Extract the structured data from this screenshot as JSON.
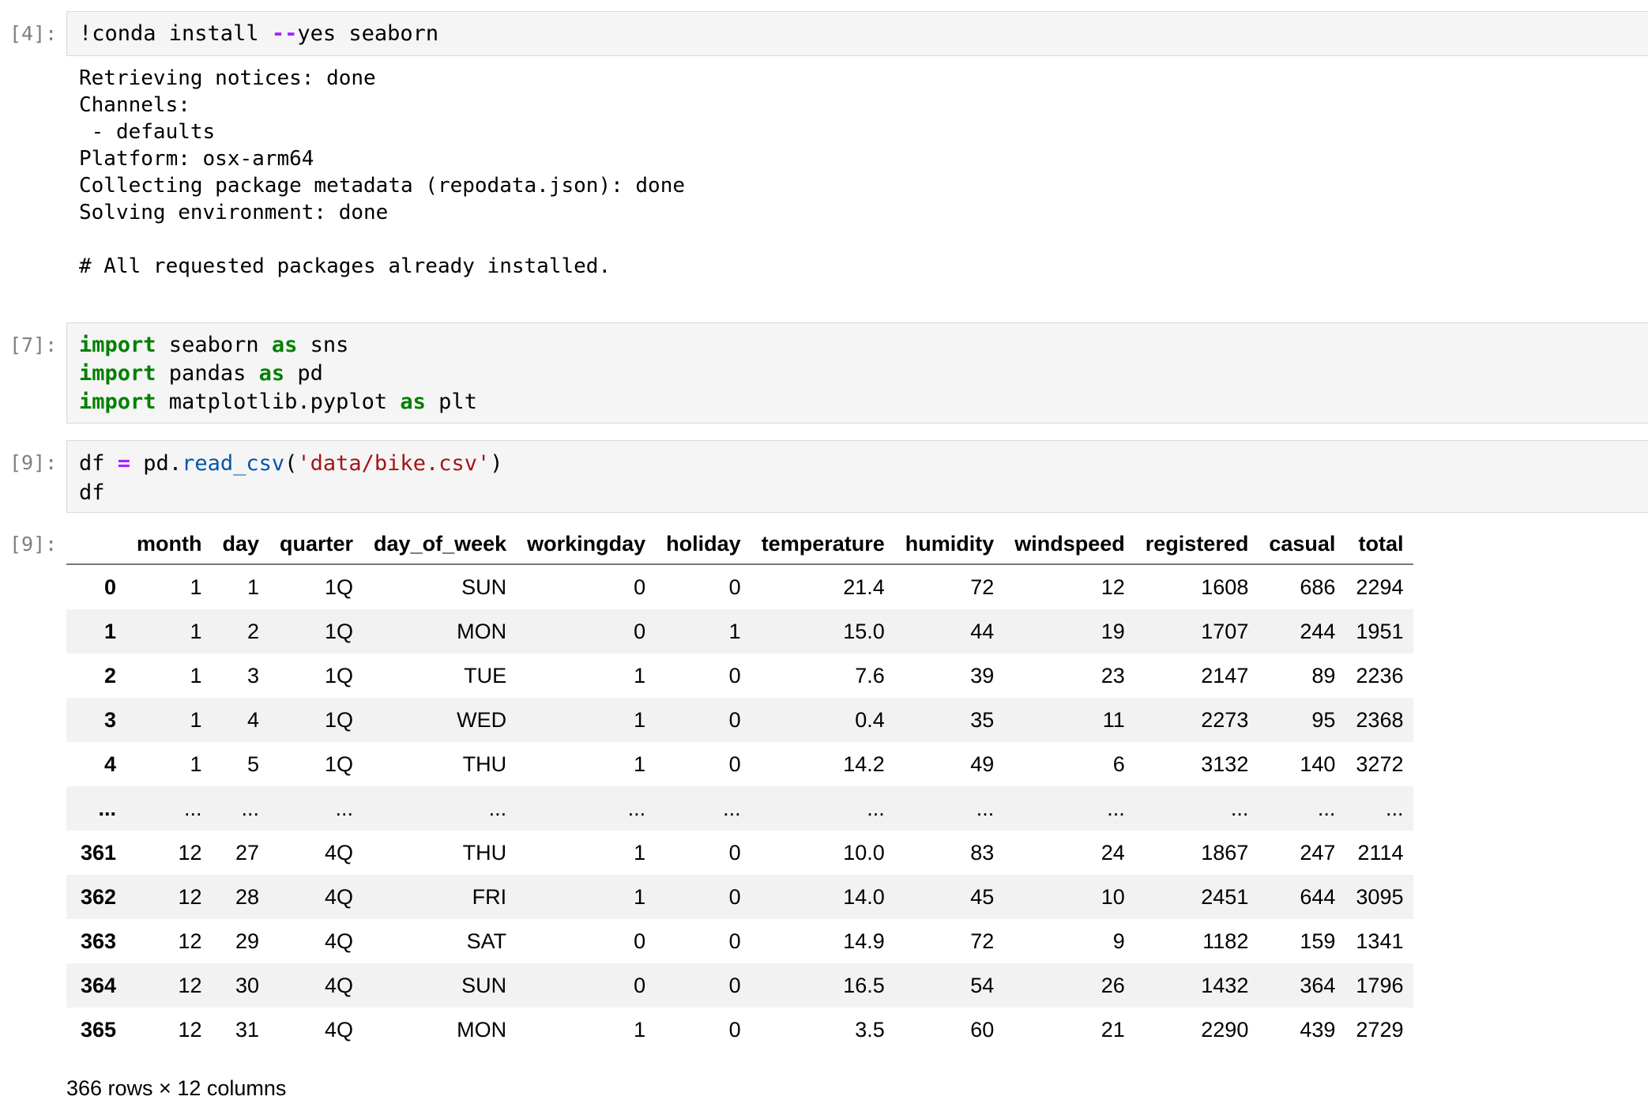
{
  "cells": [
    {
      "prompt": "[4]:",
      "code_parts": {
        "p1": "!conda install ",
        "p2": "--",
        "p3": "yes seaborn"
      },
      "output_lines": [
        "Retrieving notices: done",
        "Channels:",
        " - defaults",
        "Platform: osx-arm64",
        "Collecting package metadata (repodata.json): done",
        "Solving environment: done",
        "",
        "# All requested packages already installed."
      ]
    },
    {
      "prompt": "[7]:",
      "lines": [
        {
          "kw1": "import",
          "mod": " seaborn ",
          "kw2": "as",
          "alias": " sns"
        },
        {
          "kw1": "import",
          "mod": " pandas ",
          "kw2": "as",
          "alias": " pd"
        },
        {
          "kw1": "import",
          "mod": " matplotlib.pyplot ",
          "kw2": "as",
          "alias": " plt"
        }
      ]
    },
    {
      "prompt": "[9]:",
      "line1": {
        "var": "df ",
        "eq": "=",
        "obj": " pd.",
        "fn": "read_csv",
        "open": "(",
        "str": "'data/bike.csv'",
        "close": ")"
      },
      "line2": "df"
    },
    {
      "prompt": "[9]:",
      "table": {
        "columns": [
          "",
          "month",
          "day",
          "quarter",
          "day_of_week",
          "workingday",
          "holiday",
          "temperature",
          "humidity",
          "windspeed",
          "registered",
          "casual",
          "total"
        ],
        "rows": [
          [
            "0",
            "1",
            "1",
            "1Q",
            "SUN",
            "0",
            "0",
            "21.4",
            "72",
            "12",
            "1608",
            "686",
            "2294"
          ],
          [
            "1",
            "1",
            "2",
            "1Q",
            "MON",
            "0",
            "1",
            "15.0",
            "44",
            "19",
            "1707",
            "244",
            "1951"
          ],
          [
            "2",
            "1",
            "3",
            "1Q",
            "TUE",
            "1",
            "0",
            "7.6",
            "39",
            "23",
            "2147",
            "89",
            "2236"
          ],
          [
            "3",
            "1",
            "4",
            "1Q",
            "WED",
            "1",
            "0",
            "0.4",
            "35",
            "11",
            "2273",
            "95",
            "2368"
          ],
          [
            "4",
            "1",
            "5",
            "1Q",
            "THU",
            "1",
            "0",
            "14.2",
            "49",
            "6",
            "3132",
            "140",
            "3272"
          ],
          [
            "...",
            "...",
            "...",
            "...",
            "...",
            "...",
            "...",
            "...",
            "...",
            "...",
            "...",
            "...",
            "..."
          ],
          [
            "361",
            "12",
            "27",
            "4Q",
            "THU",
            "1",
            "0",
            "10.0",
            "83",
            "24",
            "1867",
            "247",
            "2114"
          ],
          [
            "362",
            "12",
            "28",
            "4Q",
            "FRI",
            "1",
            "0",
            "14.0",
            "45",
            "10",
            "2451",
            "644",
            "3095"
          ],
          [
            "363",
            "12",
            "29",
            "4Q",
            "SAT",
            "0",
            "0",
            "14.9",
            "72",
            "9",
            "1182",
            "159",
            "1341"
          ],
          [
            "364",
            "12",
            "30",
            "4Q",
            "SUN",
            "0",
            "0",
            "16.5",
            "54",
            "26",
            "1432",
            "364",
            "1796"
          ],
          [
            "365",
            "12",
            "31",
            "4Q",
            "MON",
            "1",
            "0",
            "3.5",
            "60",
            "21",
            "2290",
            "439",
            "2729"
          ]
        ],
        "shape_text": "366 rows × 12 columns"
      }
    }
  ]
}
